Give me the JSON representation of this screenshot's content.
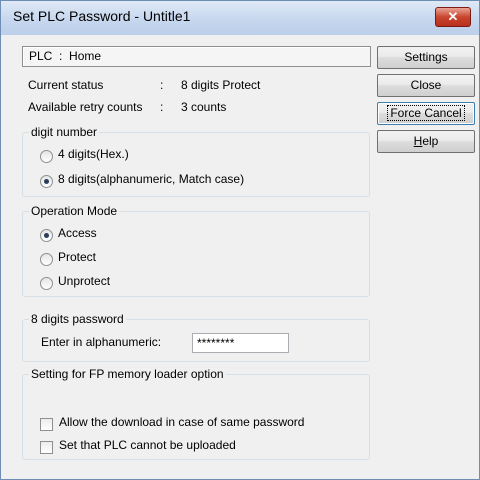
{
  "window": {
    "title": "Set PLC Password - Untitle1"
  },
  "plc": {
    "label": "PLC",
    "separator": ":",
    "value": "Home"
  },
  "status": {
    "current_label": "Current status",
    "current_sep": ":",
    "current_value": "8 digits Protect",
    "retry_label": "Available retry counts",
    "retry_sep": ":",
    "retry_value": "3 counts"
  },
  "buttons": {
    "settings": "Settings",
    "close": "Close",
    "force_cancel": "Force Cancel",
    "help_prefix": "H",
    "help_rest": "elp"
  },
  "digit_number": {
    "legend": "digit number",
    "options": [
      {
        "label": "4 digits(Hex.)",
        "selected": false
      },
      {
        "label": "8 digits(alphanumeric, Match case)",
        "selected": true
      }
    ]
  },
  "operation_mode": {
    "legend": "Operation Mode",
    "options": [
      {
        "label": "Access",
        "selected": true
      },
      {
        "label": "Protect",
        "selected": false
      },
      {
        "label": "Unprotect",
        "selected": false
      }
    ]
  },
  "password": {
    "legend": "8 digits password",
    "label": "Enter in alphanumeric:",
    "value": "********"
  },
  "fp_memory": {
    "legend": "Setting for FP memory loader option",
    "options": [
      {
        "label": "Allow the download in case of same password",
        "checked": false
      },
      {
        "label": "Set that PLC cannot be uploaded",
        "checked": false
      }
    ]
  },
  "colors": {
    "close_button": "#c9452f",
    "titlebar": "#c6d7ee",
    "focus_border": "#3c7fb1"
  }
}
